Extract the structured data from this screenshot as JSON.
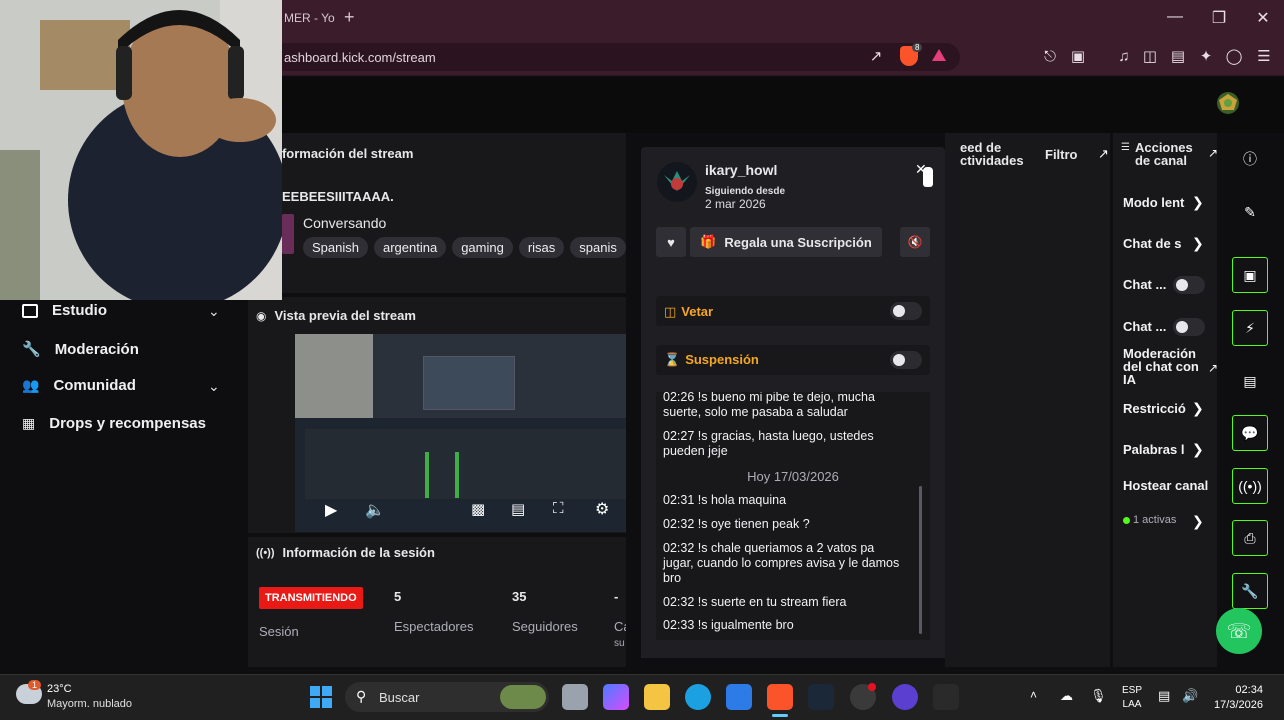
{
  "browser": {
    "tab_title": "MER - Yo",
    "new_tab": "+",
    "url": "ashboard.kick.com/stream",
    "shield_badge": "8"
  },
  "sidebar": {
    "items": [
      {
        "label": "Estudio",
        "icon": "studio-icon",
        "has_chevron": true
      },
      {
        "label": "Moderación",
        "icon": "wrench-icon",
        "has_chevron": false
      },
      {
        "label": "Comunidad",
        "icon": "community-icon",
        "has_chevron": true
      },
      {
        "label": "Drops y recompensas",
        "icon": "drops-icon",
        "has_chevron": false
      }
    ]
  },
  "stream_info": {
    "heading": "nformación del stream",
    "title": "EEBEESIIITAAAA.",
    "category": "Conversando",
    "tags": [
      "Spanish",
      "argentina",
      "gaming",
      "risas",
      "spanis"
    ]
  },
  "preview": {
    "heading": "Vista previa del stream"
  },
  "session": {
    "heading": "Información de la sesión",
    "live_badge": "TRANSMITIENDO",
    "session_label": "Sesión",
    "viewers_value": "5",
    "viewers_label": "Espectadores",
    "followers_value": "35",
    "followers_label": "Seguidores",
    "extra_value": "-",
    "extra_label": "Ca",
    "extra_label2": "su"
  },
  "activity": {
    "heading": "Feed de actividades",
    "heading_line1": "eed de",
    "heading_line2": "ctividades",
    "filter": "Filtro"
  },
  "user_card": {
    "username": "ikary_howl",
    "following_since_label": "Siguiendo desde",
    "following_since_date": "2 mar 2026",
    "gift_label": "Regala una Suscripción"
  },
  "moderation": {
    "ban_label": "Vetar",
    "timeout_label": "Suspensión",
    "chat": [
      {
        "time": "02:26",
        "text": "!s bueno mi pibe te dejo, mucha suerte, solo me pasaba a saludar"
      },
      {
        "time": "02:27",
        "text": "!s gracias, hasta luego, ustedes pueden jeje"
      }
    ],
    "date_divider": "Hoy 17/03/2026",
    "chat_today": [
      {
        "time": "02:31",
        "text": "!s hola maquina"
      },
      {
        "time": "02:32",
        "text": "!s oye tienen peak ?"
      },
      {
        "time": "02:32",
        "text": "!s chale queriamos a 2 vatos pa jugar, cuando lo compres avisa y le damos bro"
      },
      {
        "time": "02:32",
        "text": "!s suerte en tu stream fiera"
      },
      {
        "time": "02:33",
        "text": "!s igualmente bro"
      }
    ]
  },
  "channel_actions": {
    "heading_line1": "Acciones",
    "heading_line2": "de canal",
    "items": [
      {
        "label": "Modo lent",
        "control": "chevron"
      },
      {
        "label": "Chat de s",
        "control": "chevron"
      },
      {
        "label": "Chat ...",
        "control": "toggle"
      },
      {
        "label": "Chat ...",
        "control": "toggle"
      },
      {
        "label": "Moderación del chat con IA",
        "control": "external"
      },
      {
        "label": "Restricció",
        "control": "chevron"
      },
      {
        "label": "Palabras l",
        "control": "chevron"
      },
      {
        "label": "Hostear canal",
        "control": "none"
      },
      {
        "label": "1 activas",
        "control": "chevron"
      }
    ]
  },
  "taskbar": {
    "weather_temp": "23°C",
    "weather_desc": "Mayorm. nublado",
    "weather_badge": "1",
    "search_placeholder": "Buscar",
    "lang_line1": "ESP",
    "lang_line2": "LAA",
    "time": "02:34",
    "date": "17/3/2026"
  },
  "colors": {
    "kick_green": "#53fc18",
    "live_red": "#e91916",
    "accent_orange": "#f5a623",
    "browser_chrome": "#3a1c2a"
  }
}
